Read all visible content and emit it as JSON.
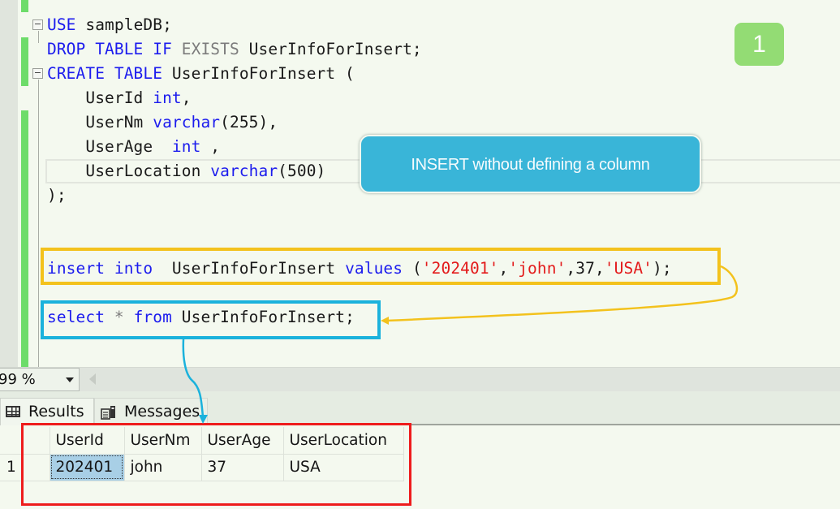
{
  "editor": {
    "lines": [
      {
        "parts": [
          {
            "t": "USE",
            "c": "kw"
          },
          {
            "t": " sampleDB;",
            "c": ""
          }
        ]
      },
      {
        "parts": [
          {
            "t": "DROP TABLE IF ",
            "c": "kw"
          },
          {
            "t": "EXISTS",
            "c": "gray"
          },
          {
            "t": " UserInfoForInsert;",
            "c": ""
          }
        ]
      },
      {
        "parts": [
          {
            "t": "CREATE TABLE",
            "c": "kw"
          },
          {
            "t": " UserInfoForInsert (",
            "c": ""
          }
        ]
      },
      {
        "parts": [
          {
            "t": "    UserId ",
            "c": ""
          },
          {
            "t": "int",
            "c": "kw"
          },
          {
            "t": ",",
            "c": ""
          }
        ]
      },
      {
        "parts": [
          {
            "t": "    UserNm ",
            "c": ""
          },
          {
            "t": "varchar",
            "c": "kw"
          },
          {
            "t": "(255),",
            "c": ""
          }
        ]
      },
      {
        "parts": [
          {
            "t": "    UserAge  ",
            "c": ""
          },
          {
            "t": "int",
            "c": "kw"
          },
          {
            "t": " ,",
            "c": ""
          }
        ]
      },
      {
        "parts": [
          {
            "t": "    UserLocation ",
            "c": ""
          },
          {
            "t": "varchar",
            "c": "kw"
          },
          {
            "t": "(500)",
            "c": ""
          }
        ]
      },
      {
        "parts": [
          {
            "t": ");",
            "c": ""
          }
        ]
      },
      {
        "parts": []
      },
      {
        "parts": []
      },
      {
        "parts": [
          {
            "t": "insert into",
            "c": "kw"
          },
          {
            "t": "  UserInfoForInsert ",
            "c": ""
          },
          {
            "t": "values",
            "c": "kw"
          },
          {
            "t": " (",
            "c": ""
          },
          {
            "t": "'202401'",
            "c": "str"
          },
          {
            "t": ",",
            "c": ""
          },
          {
            "t": "'john'",
            "c": "str"
          },
          {
            "t": ",37,",
            "c": ""
          },
          {
            "t": "'USA'",
            "c": "str"
          },
          {
            "t": ");",
            "c": ""
          }
        ]
      },
      {
        "parts": []
      },
      {
        "parts": [
          {
            "t": "select",
            "c": "kw"
          },
          {
            "t": " * ",
            "c": "gray"
          },
          {
            "t": "from",
            "c": "kw"
          },
          {
            "t": " UserInfoForInsert;",
            "c": ""
          }
        ]
      }
    ]
  },
  "annotations": {
    "callout_text": "INSERT without defining a column",
    "step_number": "1",
    "colors": {
      "insert_highlight": "#f3c21d",
      "select_highlight": "#1bb2dc",
      "results_highlight": "#ee1c1c",
      "callout_bg": "#39b5d8",
      "step_badge_bg": "#93dc74"
    }
  },
  "toolbar": {
    "zoom_level": "99 %"
  },
  "tabs": {
    "results_label": "Results",
    "messages_label": "Messages"
  },
  "results_grid": {
    "columns": [
      "UserId",
      "UserNm",
      "UserAge",
      "UserLocation"
    ],
    "rows": [
      {
        "row_number": "1",
        "cells": [
          "202401",
          "john",
          "37",
          "USA"
        ]
      }
    ]
  }
}
